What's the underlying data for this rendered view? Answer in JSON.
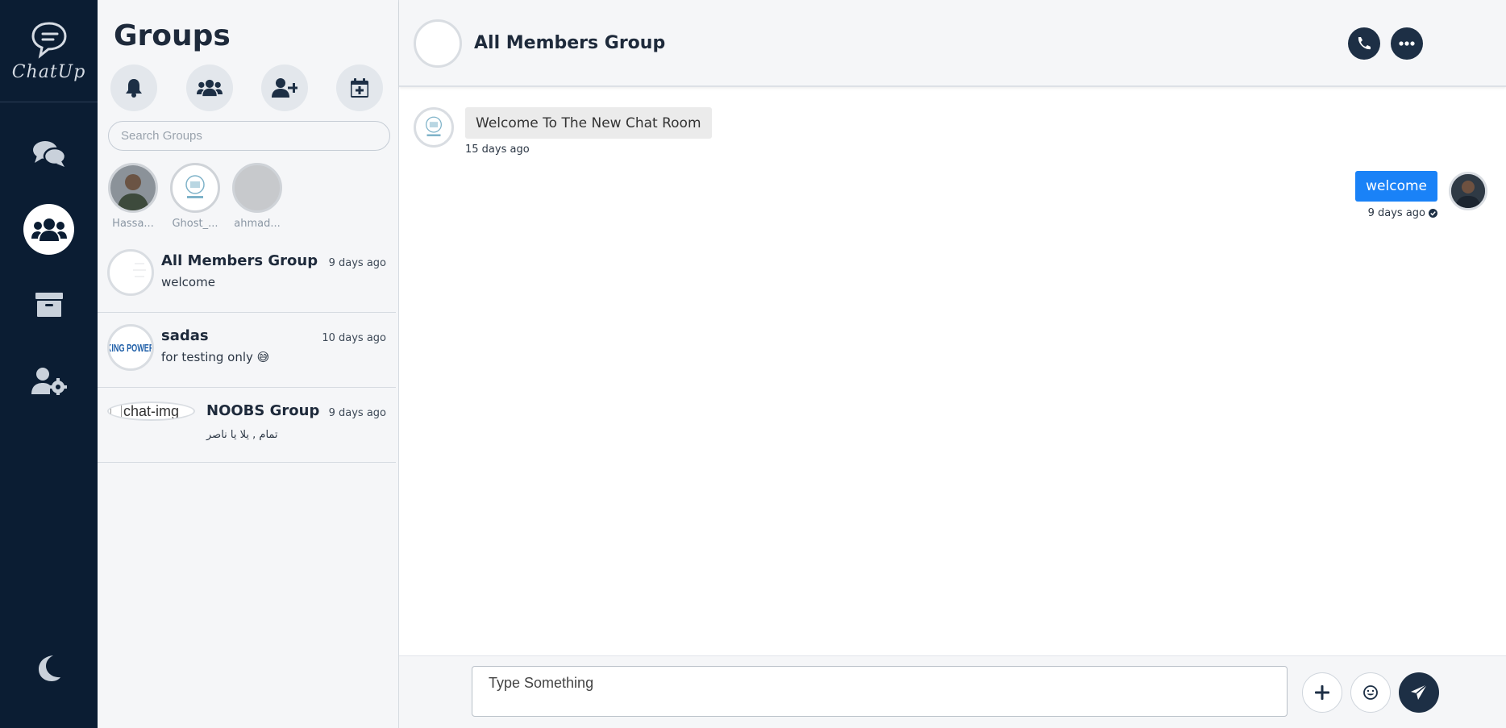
{
  "app": {
    "logo_text": "ChatUp"
  },
  "groups_panel": {
    "title": "Groups",
    "search_placeholder": "Search Groups",
    "online_users": [
      {
        "name": "Hassa..."
      },
      {
        "name": "Ghost_..."
      },
      {
        "name": "ahmad..."
      }
    ],
    "chats": [
      {
        "title": "All Members Group",
        "last_message": "welcome",
        "time": "9 days ago"
      },
      {
        "title": "sadas",
        "last_message": "for testing only 😅",
        "time": "10 days ago",
        "avatar_text": "KING POWER"
      },
      {
        "title": "NOOBS Group",
        "last_message": "تمام , يلا يا ناصر",
        "time": "9 days ago",
        "broken_image_alt": "chat-img"
      }
    ]
  },
  "chat": {
    "title": "All Members Group",
    "messages": [
      {
        "direction": "incoming",
        "text": "Welcome To The New Chat Room",
        "time": "15 days ago"
      },
      {
        "direction": "outgoing",
        "text": "welcome",
        "time": "9 days ago"
      }
    ],
    "composer_placeholder": "Type Something"
  },
  "colors": {
    "rail_bg": "#0b1d33",
    "panel_bg": "#f5f6f8",
    "accent_blue": "#1a82f7",
    "dark_button": "#1d2f45"
  },
  "icons": {
    "rail": [
      "chat-icon",
      "groups-icon",
      "archive-icon",
      "user-settings-icon",
      "moon-icon"
    ],
    "group_actions": [
      "bell-icon",
      "users-icon",
      "user-plus-icon",
      "calendar-plus-icon"
    ],
    "header": [
      "phone-icon",
      "more-icon"
    ],
    "composer": [
      "plus-icon",
      "emoji-icon",
      "send-icon"
    ]
  }
}
